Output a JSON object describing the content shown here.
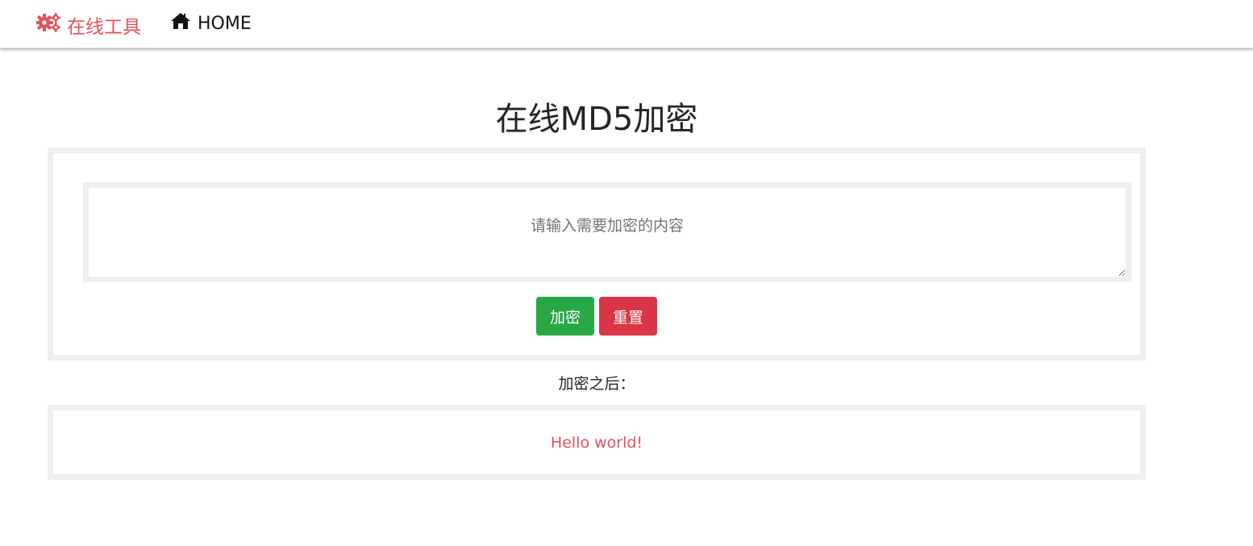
{
  "nav": {
    "brand_label": "在线工具",
    "brand_icon": "gears-icon",
    "home_label": "HOME",
    "home_icon": "home-icon"
  },
  "main": {
    "title": "在线MD5加密",
    "input": {
      "placeholder": "请输入需要加密的内容",
      "value": ""
    },
    "buttons": {
      "encrypt_label": "加密",
      "reset_label": "重置"
    },
    "result_label": "加密之后：",
    "result_value": "Hello world!"
  },
  "colors": {
    "brand": "#e8505b",
    "encrypt_button": "#28a745",
    "reset_button": "#dc3545",
    "panel_border": "#eeeeee"
  }
}
